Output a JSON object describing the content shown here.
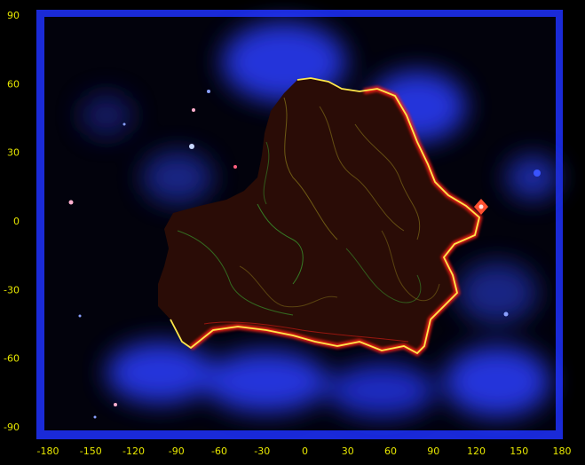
{
  "map": {
    "projection": "equirectangular",
    "colors": {
      "frame": "#1a2ad8",
      "space": "#02020c",
      "nebula": "#2a3cff",
      "land": "#2a0c06",
      "coast": "#ffe84a",
      "coast_red": "#ff2018",
      "contour_green": "#3aa832",
      "contour_olive": "#8a7a1a",
      "tick_label": "#e8e800"
    },
    "x_axis": {
      "ticks": [
        "-180",
        "-150",
        "-120",
        "-90",
        "-60",
        "-30",
        "0",
        "30",
        "60",
        "90",
        "120",
        "150",
        "180"
      ]
    },
    "y_axis": {
      "ticks": [
        "90",
        "60",
        "30",
        "0",
        "-30",
        "-60",
        "-90"
      ]
    },
    "extent": {
      "lon": [
        -180,
        180
      ],
      "lat": [
        -90,
        90
      ]
    }
  }
}
